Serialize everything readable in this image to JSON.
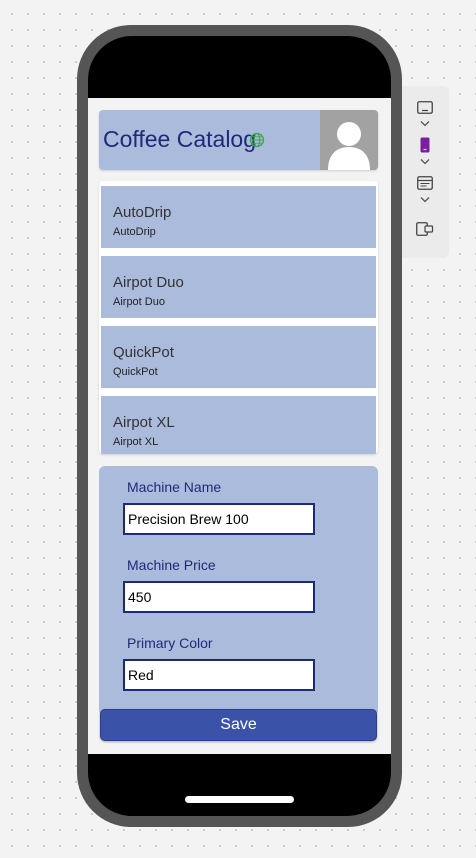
{
  "app": {
    "title": "Coffee Catalog",
    "colors": {
      "header_bg": "#abbbdc",
      "title_text": "#1e2a78",
      "button_bg": "#3a52a8",
      "globe": "#3fa34d",
      "toolbar_accent": "#7b1fa2"
    },
    "icons": {
      "globe": "globe-icon",
      "avatar": "user-avatar-icon"
    }
  },
  "gallery": {
    "items": [
      {
        "title": "AutoDrip",
        "subtitle": "AutoDrip"
      },
      {
        "title": "Airpot Duo",
        "subtitle": "Airpot Duo"
      },
      {
        "title": "QuickPot",
        "subtitle": "QuickPot"
      },
      {
        "title": "Airpot XL",
        "subtitle": "Airpot XL"
      }
    ]
  },
  "form": {
    "fields": [
      {
        "label": "Machine Name",
        "value": "Precision Brew 100"
      },
      {
        "label": "Machine Price",
        "value": "450"
      },
      {
        "label": "Primary Color",
        "value": "Red"
      }
    ],
    "save_label": "Save"
  },
  "toolbar": {
    "icons": [
      "tablet-landscape-icon",
      "phone-portrait-icon",
      "layout-icon",
      "preview-icon"
    ]
  }
}
